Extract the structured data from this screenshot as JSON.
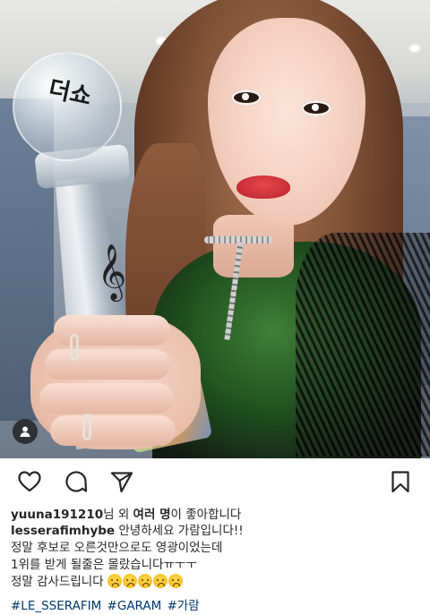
{
  "post": {
    "trophy_logo_text": "더쇼",
    "trophy_symbol": "𝄞"
  },
  "actions": {
    "like_icon": "heart-icon",
    "comment_icon": "comment-icon",
    "share_icon": "paper-plane-icon",
    "save_icon": "bookmark-icon"
  },
  "likes": {
    "user": "yuuna191210",
    "suffix": "님 외 ",
    "others": "여러 명",
    "tail": "이 좋아합니다"
  },
  "caption": {
    "username": "lesserafimhybe",
    "line1": " 안녕하세요 가람입니다!!",
    "line2": "정말 후보로 오른것만으로도 영광이었는데",
    "line3": "1위를 받게 될줄은 몰랐습니다ㅠㅜㅜ",
    "line4": "정말 감사드립니다 ",
    "emoji_count": 5
  },
  "hashtags": [
    "#LE_SSERAFIM",
    "#GARAM",
    "#가람"
  ],
  "colors": {
    "text": "#262626",
    "hashtag": "#00376b",
    "background": "#ffffff"
  }
}
